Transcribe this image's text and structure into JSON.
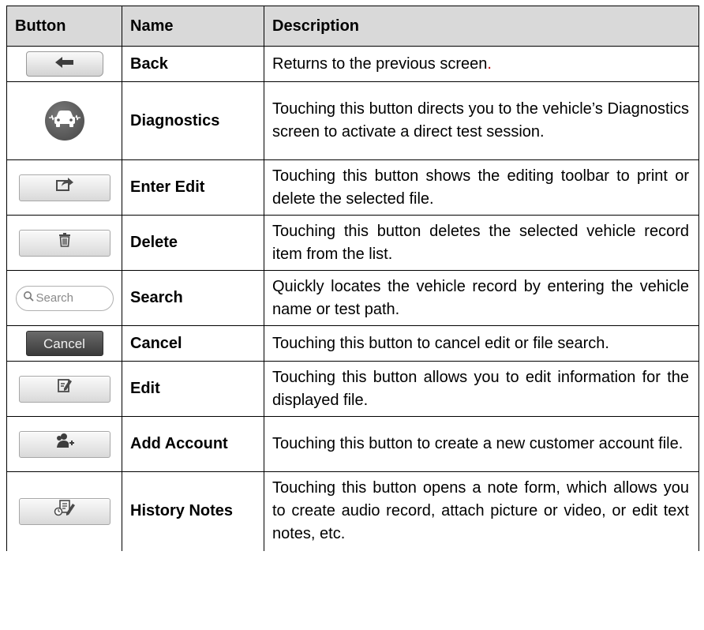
{
  "headers": {
    "button": "Button",
    "name": "Name",
    "description": "Description"
  },
  "rows": [
    {
      "icon": "back-arrow-icon",
      "name": "Back",
      "desc": "Returns to the previous screen",
      "desc_tail": "."
    },
    {
      "icon": "car-diagnostics-icon",
      "name": "Diagnostics",
      "desc": "Touching this button directs you to the vehicle’s Diagnostics screen to activate a direct test session."
    },
    {
      "icon": "share-edit-icon",
      "name": "Enter Edit",
      "desc": "Touching this button shows the editing toolbar to print or delete the selected file."
    },
    {
      "icon": "trash-icon",
      "name": "Delete",
      "desc": "Touching this button deletes the selected vehicle record item from the list."
    },
    {
      "icon": "search-icon",
      "name": "Search",
      "desc": "Quickly locates the vehicle record by entering the vehicle name or test path.",
      "icon_text": "Search"
    },
    {
      "icon": "cancel-icon",
      "name": "Cancel",
      "desc": "Touching this button to cancel edit or file search.",
      "icon_text": "Cancel"
    },
    {
      "icon": "edit-note-icon",
      "name": "Edit",
      "desc": "Touching this button allows you to edit information for the displayed file."
    },
    {
      "icon": "add-account-icon",
      "name": "Add Account",
      "desc": "Touching this button to create a new customer account file."
    },
    {
      "icon": "history-notes-icon",
      "name": "History Notes",
      "desc": "Touching this button opens a note form, which allows you to create audio record, attach picture or video, or edit text notes, etc."
    }
  ]
}
